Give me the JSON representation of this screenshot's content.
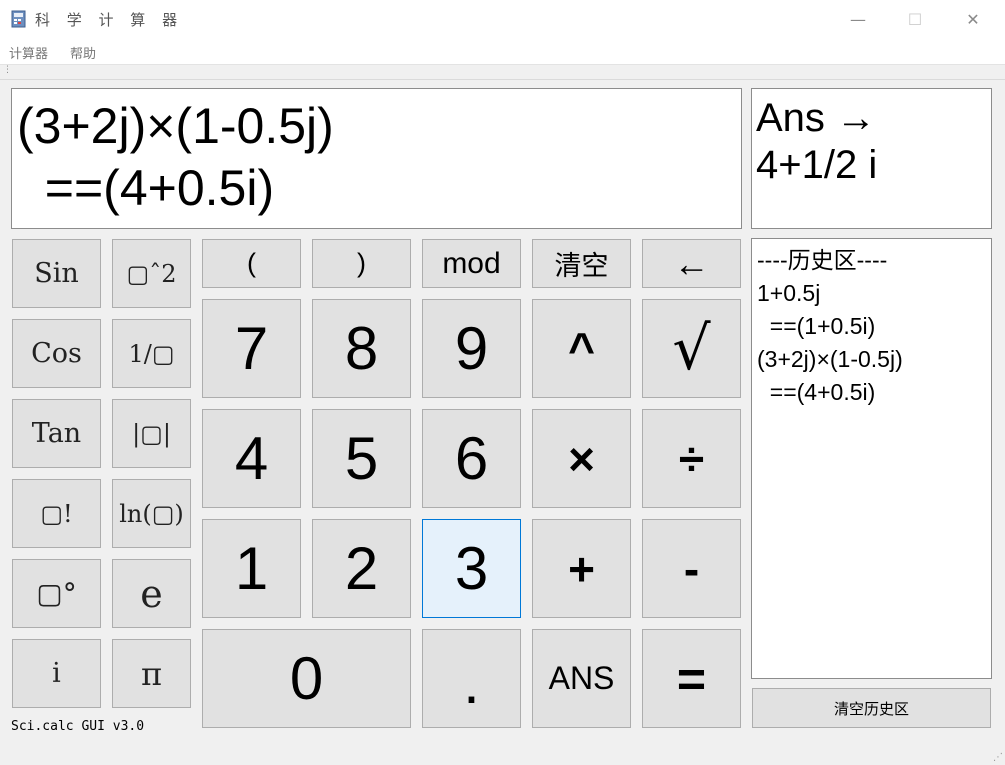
{
  "window": {
    "title": "科 学 计 算 器",
    "minimize": "—",
    "maximize": "☐",
    "close": "✕"
  },
  "menu": {
    "items": [
      "计算器",
      "帮助"
    ]
  },
  "display": {
    "expression": "(3+2j)×(1-0.5j)\n  ==(4+0.5i)"
  },
  "ans_panel": {
    "text": "Ans →\n4+1/2 i"
  },
  "history": {
    "text": "----历史区----\n1+0.5j\n  ==(1+0.5i)\n(3+2j)×(1-0.5j)\n  ==(4+0.5i)",
    "clear_label": "清空历史区"
  },
  "sci_keys": {
    "sin": "Sin",
    "square": "▢ˆ2",
    "cos": "Cos",
    "reciprocal": "1/▢",
    "tan": "Tan",
    "abs": "|▢|",
    "factorial": "▢!",
    "ln": "ln(▢)",
    "degree": "▢°",
    "e": "e",
    "i": "i",
    "pi": "π"
  },
  "keys": {
    "lparen": "(",
    "rparen": ")",
    "mod": "mod",
    "clear": "清空",
    "backspace": "←",
    "n7": "7",
    "n8": "8",
    "n9": "9",
    "pow": "^",
    "sqrt": "√",
    "n4": "4",
    "n5": "5",
    "n6": "6",
    "mul": "×",
    "div": "÷",
    "n1": "1",
    "n2": "2",
    "n3": "3",
    "add": "+",
    "sub": "-",
    "n0": "0",
    "dot": ".",
    "ans": "ANS",
    "eq": "="
  },
  "version": "Sci.calc GUI v3.0",
  "colors": {
    "selected_border": "#0078d7",
    "button_bg": "#e1e1e1"
  }
}
